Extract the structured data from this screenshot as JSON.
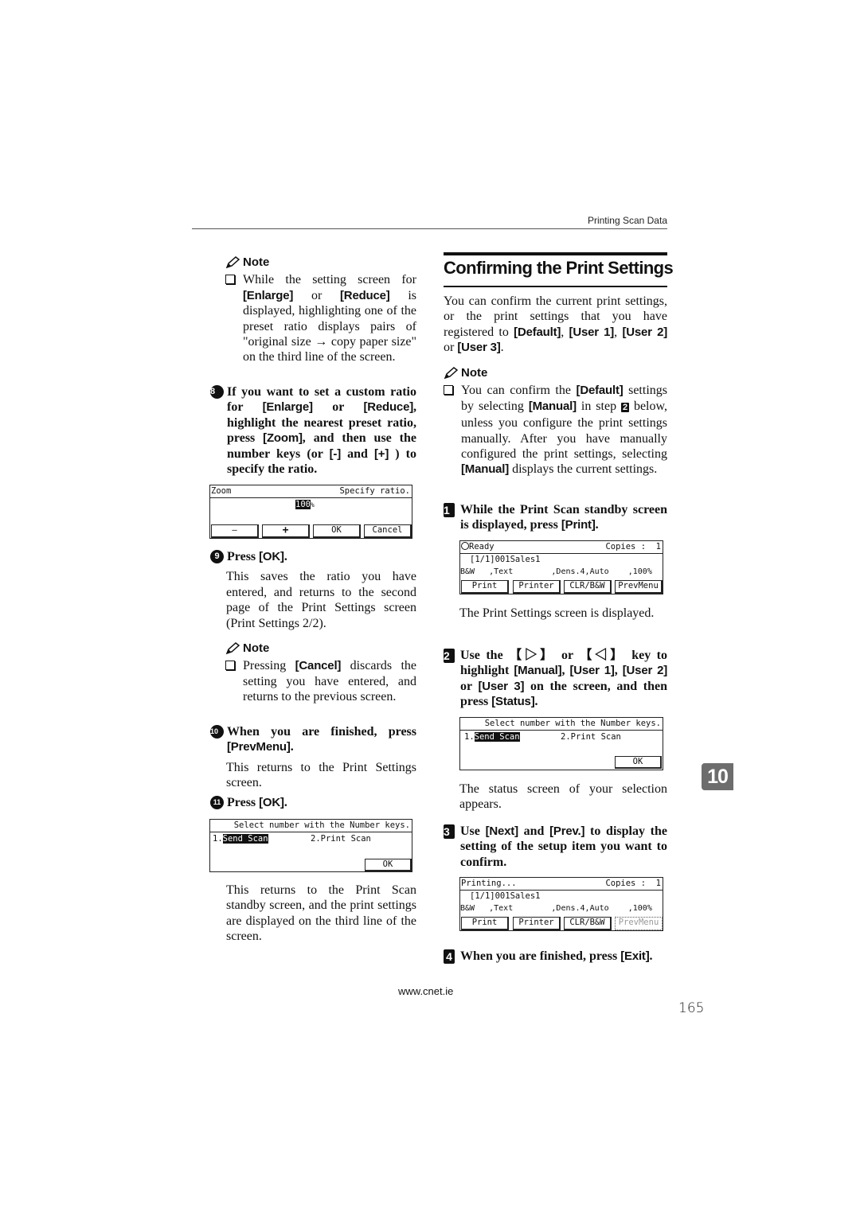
{
  "running_head": "Printing Scan Data",
  "left": {
    "note1": {
      "heading": "Note",
      "parts": [
        "While the setting screen for ",
        "[Enlarge]",
        " or ",
        "[Reduce]",
        " is displayed, highlighting one of the preset ratio displays pairs of \"original size → copy paper size\" on the third line of the screen."
      ]
    },
    "step8": {
      "marker": "8",
      "parts": [
        "If you want to set a custom ratio for ",
        "[Enlarge]",
        " or ",
        "[Reduce]",
        ", highlight the nearest preset ratio, press ",
        "[Zoom]",
        ", and then use the number keys (or ",
        "[-]",
        " and ",
        "[+]",
        " ) to specify the ratio."
      ]
    },
    "lcd_zoom": {
      "title": "Zoom",
      "hint": "Specify ratio.",
      "value": "100",
      "unit": "%",
      "buttons": [
        "—",
        "+",
        "OK",
        "Cancel"
      ]
    },
    "step9": {
      "marker": "9",
      "parts": [
        "Press ",
        "[OK]",
        "."
      ],
      "body": "This saves the ratio you have entered, and returns to the second page of the Print Settings screen (Print Settings 2/2)."
    },
    "note2": {
      "heading": "Note",
      "parts": [
        "Pressing ",
        "[Cancel]",
        " discards the setting you have entered, and returns to the previous screen."
      ]
    },
    "step10": {
      "marker": "10",
      "parts": [
        "When you are finished, press ",
        "[PrevMenu]",
        "."
      ],
      "body": "This returns to the Print Settings screen."
    },
    "step11": {
      "marker": "11",
      "parts": [
        "Press ",
        "[OK]",
        "."
      ]
    },
    "lcd_select": {
      "prompt": "Select number with the Number keys.",
      "opt1_num": "1.",
      "opt1": "Send Scan",
      "opt2": "2.Print Scan",
      "ok": "OK"
    },
    "closing": "This returns to the Print Scan standby screen, and the print settings are displayed on the third line of the screen."
  },
  "right": {
    "section_title": "Confirming the Print Settings",
    "intro_parts": [
      "You can confirm the current print settings, or the print settings that you have registered to ",
      "[Default]",
      ", ",
      "[User 1]",
      ", ",
      "[User 2]",
      " or ",
      "[User 3]",
      "."
    ],
    "note": {
      "heading": "Note",
      "parts": [
        "You can confirm the ",
        "[Default]",
        " settings by selecting ",
        "[Manual]",
        " in step ",
        "2",
        " below, unless you configure the print settings manually. After you have manually configured the print settings, selecting ",
        "[Manual]",
        " displays the current settings."
      ]
    },
    "step1": {
      "marker": "1",
      "parts": [
        "While the Print Scan standby screen is displayed, press ",
        "[Print]",
        "."
      ],
      "body": "The Print Settings screen is displayed."
    },
    "lcd_ready": {
      "status": "Ready",
      "copies_label": "Copies :",
      "copies": "1",
      "file": "[1/1]001Sales1",
      "settings": [
        "B&W",
        ",Text",
        ",Dens.4,Auto",
        ",100%"
      ],
      "buttons": [
        "Print",
        "Printer",
        "CLR/B&W",
        "PrevMenu"
      ]
    },
    "step2": {
      "marker": "2",
      "parts": [
        "Use the 【▷】 or 【◁】 key to highlight ",
        "[Manual]",
        ", ",
        "[User 1]",
        ", ",
        "[User 2]",
        " or ",
        "[User 3]",
        " on the screen, and then press ",
        "[Status]",
        "."
      ],
      "body": "The status screen of your selection appears."
    },
    "lcd_select": {
      "prompt": "Select number with the Number keys.",
      "opt1_num": "1.",
      "opt1": "Send Scan",
      "opt2": "2.Print Scan",
      "ok": "OK"
    },
    "step3": {
      "marker": "3",
      "parts": [
        "Use ",
        "[Next]",
        " and ",
        "[Prev.]",
        " to display the setting of the setup item you want to confirm."
      ]
    },
    "lcd_printing": {
      "status": "Printing...",
      "copies_label": "Copies :",
      "copies": "1",
      "file": "[1/1]001Sales1",
      "settings": [
        "B&W",
        ",Text",
        ",Dens.4,Auto",
        ",100%"
      ],
      "buttons": [
        "Print",
        "Printer",
        "CLR/B&W",
        "PrevMenu"
      ]
    },
    "step4": {
      "marker": "4",
      "parts": [
        "When you are finished, press ",
        "[Exit]",
        "."
      ]
    }
  },
  "chapter_tab": "10",
  "footer_url": "www.cnet.ie",
  "page_number": "165"
}
